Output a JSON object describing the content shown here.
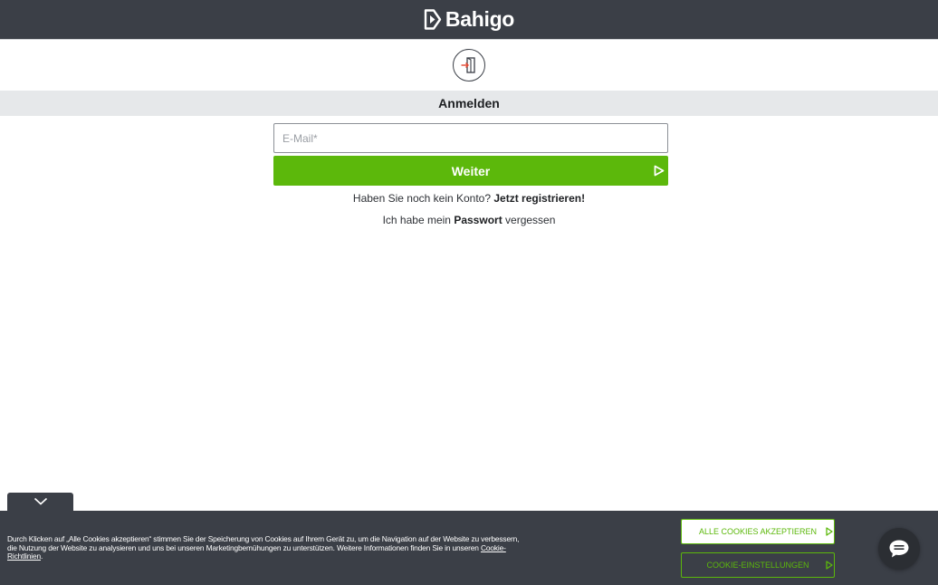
{
  "header": {
    "logo_text": "Bahigo",
    "logo_icon": "bahigo-play-icon",
    "background": "#3b3f47"
  },
  "login": {
    "icon": "door-enter-icon",
    "title": "Anmelden",
    "email_placeholder": "E-Mail*",
    "email_value": "",
    "submit_label": "Weiter",
    "submit_icon": "play-icon",
    "accent": "#5cb80b",
    "register_prompt": "Haben Sie noch kein Konto?",
    "register_link": "Jetzt registrieren!",
    "forgot_prefix": "Ich habe mein",
    "forgot_link": "Passwort",
    "forgot_suffix": "vergessen"
  },
  "cookie": {
    "collapse_icon": "chevron-down-icon",
    "text": "Durch Klicken auf „Alle Cookies akzeptieren“ stimmen Sie der Speicherung von Cookies auf Ihrem Gerät zu, um die Navigation auf der Website zu verbessern, die Nutzung der Website zu analysieren und uns bei unseren Marketingbemühungen zu unterstützen. Weitere Informationen finden Sie in unseren",
    "link": "Cookie-Richtlinien",
    "link_suffix": ".",
    "accept_label": "ALLE COOKIES AKZEPTIEREN",
    "settings_label": "COOKIE-EINSTELLUNGEN"
  },
  "chat": {
    "icon": "chat-bubble-icon"
  }
}
